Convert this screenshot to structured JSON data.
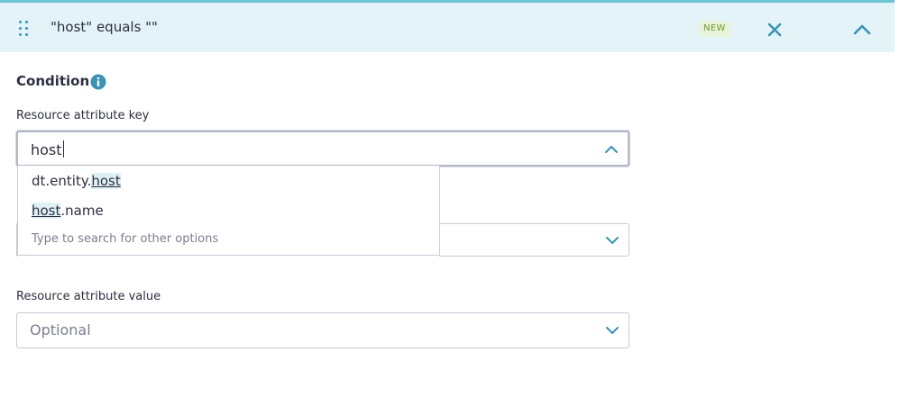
{
  "header": {
    "title": "\"host\" equals \"\"",
    "badge": "NEW"
  },
  "condition": {
    "title": "Condition"
  },
  "key_field": {
    "label": "Resource attribute key",
    "value": "host"
  },
  "dropdown": {
    "options": [
      {
        "prefix": "dt.entity.",
        "match": "host",
        "suffix": ""
      },
      {
        "prefix": "",
        "match": "host",
        "suffix": ".name"
      }
    ],
    "search_hint": "Type to search for other options"
  },
  "value_field": {
    "label": "Resource attribute value",
    "placeholder": "Optional"
  },
  "colors": {
    "accent": "#3a93b5",
    "header_bg": "#e3f3f7",
    "badge_bg": "#e8f4d9",
    "badge_text": "#6a9a31"
  },
  "icons": [
    "drag-handle-icon",
    "close-icon",
    "chevron-up-icon",
    "info-icon",
    "chevron-down-icon"
  ]
}
